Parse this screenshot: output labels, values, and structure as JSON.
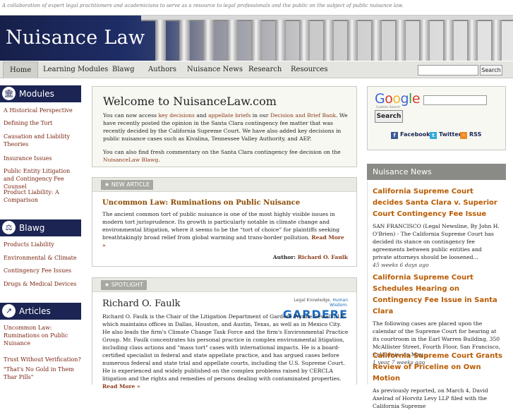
{
  "tagline": "A collaboration of expert legal practitioners and academicians to serve as a resource to legal professionals and the public on the subject of public nuisance law.",
  "site_title": "Nuisance Law",
  "nav": {
    "tabs": [
      "Home",
      "Learning Modules",
      "Blawg",
      "Authors",
      "Nuisance News",
      "Research",
      "Resources"
    ],
    "active": "Home",
    "search_button": "Search",
    "search_value": ""
  },
  "sidebar": {
    "modules": {
      "title": "Modules",
      "icon": "building-icon",
      "items": [
        "A Historical Perspective",
        "Defining the Tort",
        "Causation and Liability Theories",
        "Insurance Issues",
        "Public Entity Litigation and Contingency Fee Counsel",
        "Product Liability: A Comparison"
      ]
    },
    "blawg": {
      "title": "Blawg",
      "icon": "scales-icon",
      "items": [
        "Products Liability",
        "Environmental & Climate",
        "Contingency Fee Issues",
        "Drugs & Medical Devices"
      ]
    },
    "articles": {
      "title": "Articles",
      "icon": "arrow-icon",
      "items": [
        "Uncommon Law: Ruminations on Public Nuisance",
        "Trust Without Verification?",
        "\"That's No Gold in Them Thar Pills\""
      ]
    }
  },
  "welcome": {
    "title": "Welcome to NuisanceLaw.com",
    "p1_a": "You can now access ",
    "p1_link1": "key decisions",
    "p1_b": " and ",
    "p1_link2": "appellate briefs",
    "p1_c": " in our ",
    "p1_link3": "Decision and Brief Bank",
    "p1_d": ". We have recently posted the opinion in the Santa Clara contingency fee matter that was recently decided by the California Supreme Court. We have also added key decisions in public nuisance cases such as Kivalina, Tennessee Valley Authority, and AEP.",
    "p2_a": "You can also find fresh commentary on the Santa Clara contingency fee decision on the ",
    "p2_link": "NuisanceLaw Blawg",
    "p2_b": "."
  },
  "article": {
    "badge": "★ NEW ARTICLE",
    "title": "Uncommon Law: Ruminations on Public Nuisance",
    "body": "The ancient common tort of public nuisance is one of the most highly visible issues in modern tort jurisprudence. Its growth is particularly notable in climate change and environmental litigation, where it seems to be the “tort of choice” for plaintiffs seeking breathtakingly broad relief from global warming and trans-border pollution.",
    "more": "Read More »",
    "author_label": "Author:",
    "author_name": "Richard O. Faulk"
  },
  "spotlight": {
    "badge": "★ SPOTLIGHT",
    "name": "Richard O. Faulk",
    "body": "Richard O. Faulk is the Chair of the Litigation Department of Gardere Wynne Sewell LLP, which maintains offices in Dallas, Houston, and Austin, Texas, as well as in Mexico City. He also leads the firm's Climate Change Task Force and the firm's Environmental Practice Group. Mr. Faulk concentrates his personal practice in complex environmental litigation, including class actions and \"mass tort\" cases with international impacts. He is a board-certified specialist in federal and state appellate practice, and has argued cases before numerous federal and state trial and appellate courts, including the U.S. Supreme Court. He is experienced and widely published on the complex problems raised by CERCLA litigation and the rights and remedies of persons dealing with contaminated properties.",
    "more": "Read More »",
    "logo_tag_a": "Legal Knowledge. ",
    "logo_tag_b": "Human Wisdom.",
    "logo_name": "GARDERE"
  },
  "google": {
    "logo": "Google",
    "sub": "Custom Search",
    "button": "Search",
    "social": [
      {
        "label": "Facebook",
        "icon": "facebook-icon",
        "color": "#3b5998"
      },
      {
        "label": "Twitter",
        "icon": "twitter-icon",
        "color": "#33aadd"
      },
      {
        "label": "RSS",
        "icon": "rss-icon",
        "color": "#f08a24"
      }
    ]
  },
  "news": {
    "title": "Nuisance News",
    "items": [
      {
        "title": "California Supreme Court decides Santa Clara v. Superior Court Contingency Fee Issue",
        "body": "SAN FRANCISCO (Legal Newsline, By John H. O'Brien) - The California Supreme Court has decided its stance on contingency fee agreements between public entities and private attorneys should be loosened...",
        "age": "45 weeks 6 days ago"
      },
      {
        "title": "California Supreme Court Schedules Hearing on Contingency Fee Issue in Santa Clara",
        "body": "The following cases are placed upon the calendar of the Supreme Court for hearing at its courtroom in the Earl Warren Building, 350 McAllister Street, Fourth Floor, San Francisco, California, on May...",
        "age": "1 year 7 weeks ago"
      },
      {
        "title": "California Supreme Court Grants Review of Priceline on Own Motion",
        "body": "As previously reported, on March 4, David Axelrad of Horvitz Levy LLP filed with the California Supreme",
        "age": ""
      }
    ]
  }
}
